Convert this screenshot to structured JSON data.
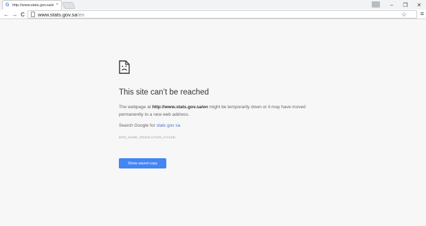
{
  "browser": {
    "tab": {
      "favicon": "G",
      "title": "http://www.stats.gov.sa/e",
      "close": "×"
    },
    "window": {
      "minimize": "–",
      "maximize": "❐",
      "close": "✕"
    },
    "toolbar": {
      "back": "←",
      "forward": "→",
      "reload": "C",
      "star": "☆",
      "menu": "≡"
    },
    "omnibox": {
      "host": "www.stats.gov.sa",
      "path": "/en"
    }
  },
  "error": {
    "icon": "sad-page-icon",
    "heading": "This site can’t be reached",
    "desc_prefix": "The webpage at ",
    "desc_url": "http://www.stats.gov.sa/en",
    "desc_suffix": " might be temporarily down or it may have moved permanently to a new web address.",
    "search_prefix": "Search Google for ",
    "search_link": "stats gov sa",
    "code": "ERR_NAME_RESOLUTION_FAILED",
    "button_label": "Show saved copy"
  },
  "colors": {
    "accent": "#4285f4",
    "link": "#4a74c9",
    "background": "#f7f7f7"
  }
}
